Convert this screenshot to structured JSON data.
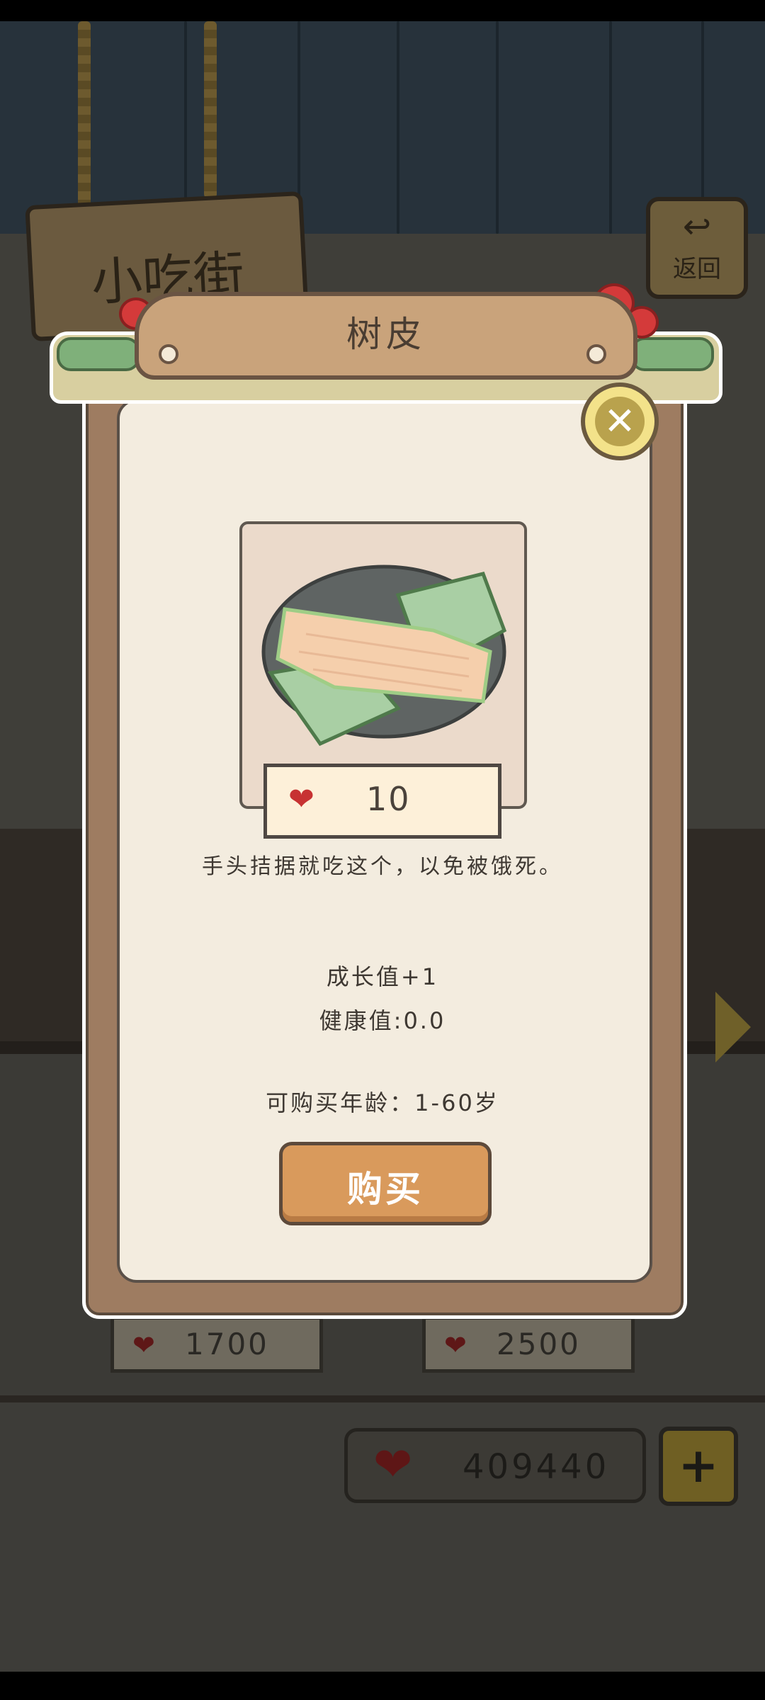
{
  "background": {
    "shop_sign": "小吃街",
    "back_button_label": "返回",
    "price_cards": [
      "1700",
      "2500"
    ],
    "currency_total": "409440",
    "add_label": "+"
  },
  "modal": {
    "title": "树皮",
    "close_label": "✕",
    "item_icon": "tree-bark-food-icon",
    "price": "10",
    "description": "手头拮据就吃这个，以免被饿死。",
    "growth": "成长值+1",
    "health": "健康值:0.0",
    "age_range": "可购买年龄：1-60岁",
    "buy_label": "购买"
  },
  "colors": {
    "heart": "#c73232",
    "buy_button": "#d99a5c",
    "panel": "#f3ecdf",
    "frame": "#9e7c61"
  }
}
